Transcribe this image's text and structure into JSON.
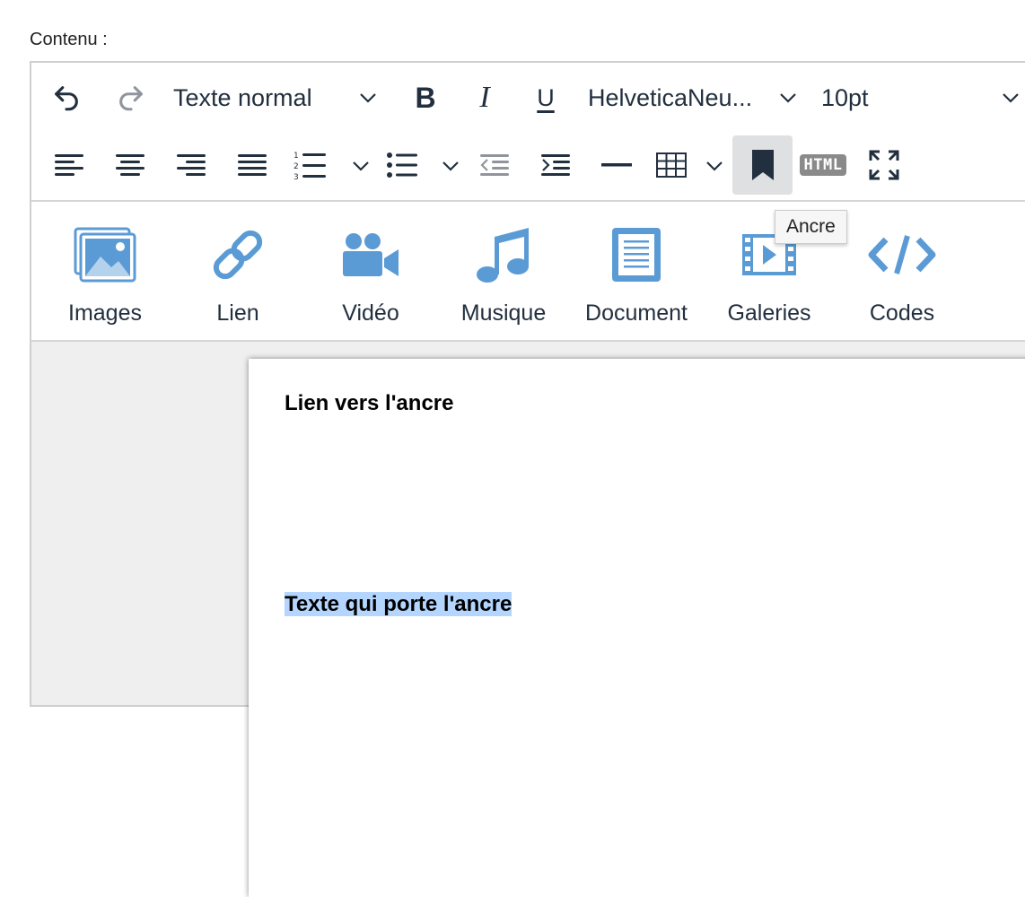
{
  "field_label": "Contenu :",
  "toolbar": {
    "undo_icon": "undo-icon",
    "redo_icon": "redo-icon",
    "block_format": "Texte normal",
    "bold_icon": "bold-icon",
    "italic_icon": "italic-icon",
    "underline_icon": "underline-icon",
    "font_family": "HelveticaNeu...",
    "font_size": "10pt",
    "html_label": "HTML",
    "active_color": "#dee0e2",
    "icon_color": "#222f3e"
  },
  "tooltip": {
    "text": "Ancre"
  },
  "media_bar": {
    "accent_color": "#5b9bd5",
    "items": [
      {
        "label": "Images",
        "icon": "images-icon"
      },
      {
        "label": "Lien",
        "icon": "link-icon"
      },
      {
        "label": "Vidéo",
        "icon": "video-camera-icon"
      },
      {
        "label": "Musique",
        "icon": "music-note-icon"
      },
      {
        "label": "Document",
        "icon": "document-icon"
      },
      {
        "label": "Galeries",
        "icon": "film-strip-icon"
      },
      {
        "label": "Codes",
        "icon": "code-icon"
      }
    ]
  },
  "content": {
    "paragraph_1": "Lien vers l'ancre",
    "paragraph_2": "Texte qui porte l'ancre",
    "selection_color": "#b4d5fe"
  }
}
